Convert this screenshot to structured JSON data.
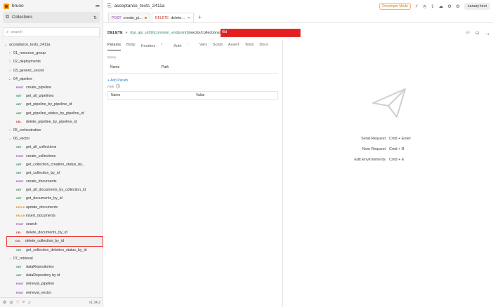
{
  "app": {
    "name": "bruno",
    "version": "v1.34.2"
  },
  "sidebar": {
    "collections_label": "Collections",
    "search_placeholder": "search",
    "tree": [
      {
        "kind": "root",
        "label": "acceptance_tests_2411a"
      },
      {
        "kind": "folder",
        "label": "01_resource_group",
        "open": false
      },
      {
        "kind": "folder",
        "label": "02_deployments",
        "open": false
      },
      {
        "kind": "folder",
        "label": "03_generic_secret",
        "open": false
      },
      {
        "kind": "folder",
        "label": "04_pipeline",
        "open": true
      },
      {
        "kind": "req",
        "method": "POST",
        "label": "create_pipeline"
      },
      {
        "kind": "req",
        "method": "GET",
        "label": "get_all_pipelines"
      },
      {
        "kind": "req",
        "method": "GET",
        "label": "get_pipeline_by_pipeline_id"
      },
      {
        "kind": "req",
        "method": "GET",
        "label": "get_pipeline_status_by_pipeline_id"
      },
      {
        "kind": "req",
        "method": "DEL",
        "label": "delete_pipeline_by_pipeline_id"
      },
      {
        "kind": "folder",
        "label": "05_orchestration",
        "open": false
      },
      {
        "kind": "folder",
        "label": "06_vector",
        "open": true
      },
      {
        "kind": "req",
        "method": "GET",
        "label": "get_all_collections"
      },
      {
        "kind": "req",
        "method": "POST",
        "label": "create_collections"
      },
      {
        "kind": "req",
        "method": "GET",
        "label": "get_collection_creation_status_by..."
      },
      {
        "kind": "req",
        "method": "GET",
        "label": "get_collection_by_id"
      },
      {
        "kind": "req",
        "method": "POST",
        "label": "create_documents"
      },
      {
        "kind": "req",
        "method": "GET",
        "label": "get_all_documents_by_collection_id"
      },
      {
        "kind": "req",
        "method": "GET",
        "label": "get_documents_by_id"
      },
      {
        "kind": "req",
        "method": "PATCH",
        "label": "update_documents"
      },
      {
        "kind": "req",
        "method": "PATCH",
        "label": "insert_documents"
      },
      {
        "kind": "req",
        "method": "POST",
        "label": "search"
      },
      {
        "kind": "req",
        "method": "DEL",
        "label": "delete_documents_by_id"
      },
      {
        "kind": "req",
        "method": "DEL",
        "label": "delete_collection_by_id",
        "selected": true
      },
      {
        "kind": "req",
        "method": "GET",
        "label": "get_collection_deletion_status_by_id"
      },
      {
        "kind": "folder",
        "label": "07_retrieval",
        "open": true
      },
      {
        "kind": "req",
        "method": "GET",
        "label": "dataRepositories"
      },
      {
        "kind": "req",
        "method": "GET",
        "label": "dataRepository by id"
      },
      {
        "kind": "req",
        "method": "POST",
        "label": "retrieval_pipeline"
      },
      {
        "kind": "req",
        "method": "POST",
        "label": "retrieval_vector"
      }
    ]
  },
  "topbar": {
    "workspace_title": "acceptance_tests_2411a",
    "dev_mode_label": "Developer Mode",
    "environment": "canary-test"
  },
  "tabs": [
    {
      "method": "POST",
      "label": "create_pi...",
      "state": "modified"
    },
    {
      "method": "DELETE",
      "label": "delete...",
      "state": "active"
    }
  ],
  "request": {
    "method": "DELETE",
    "url_var1": "{{ai_api_url}}",
    "url_var2": "{{common_endpoint}}",
    "url_path": "/vector/collections/",
    "url_redacted_prefix": "f0d"
  },
  "req_tabs": [
    {
      "label": "Params",
      "active": true
    },
    {
      "label": "Body"
    },
    {
      "label": "Headers",
      "sup": "1"
    },
    {
      "label": "Auth",
      "sup": "*"
    },
    {
      "label": "Vars"
    },
    {
      "label": "Script"
    },
    {
      "label": "Assert"
    },
    {
      "label": "Tests"
    },
    {
      "label": "Docs"
    }
  ],
  "params": {
    "query_label": "Query",
    "query_col_name": "Name",
    "query_col_path": "Path",
    "add_param": "+ Add Param",
    "path_label": "Path",
    "path_col_name": "Name",
    "path_col_value": "Value"
  },
  "response": {
    "shortcuts": [
      {
        "label": "Send Request",
        "keys": "Cmd + Enter"
      },
      {
        "label": "New Request",
        "keys": "Cmd + B"
      },
      {
        "label": "Edit Environments",
        "keys": "Cmd + E"
      }
    ]
  },
  "colors": {
    "get": "#2e8b57",
    "post": "#8e44ad",
    "delete": "#c0392b",
    "patch": "#d68910",
    "highlight": "#e53935"
  }
}
